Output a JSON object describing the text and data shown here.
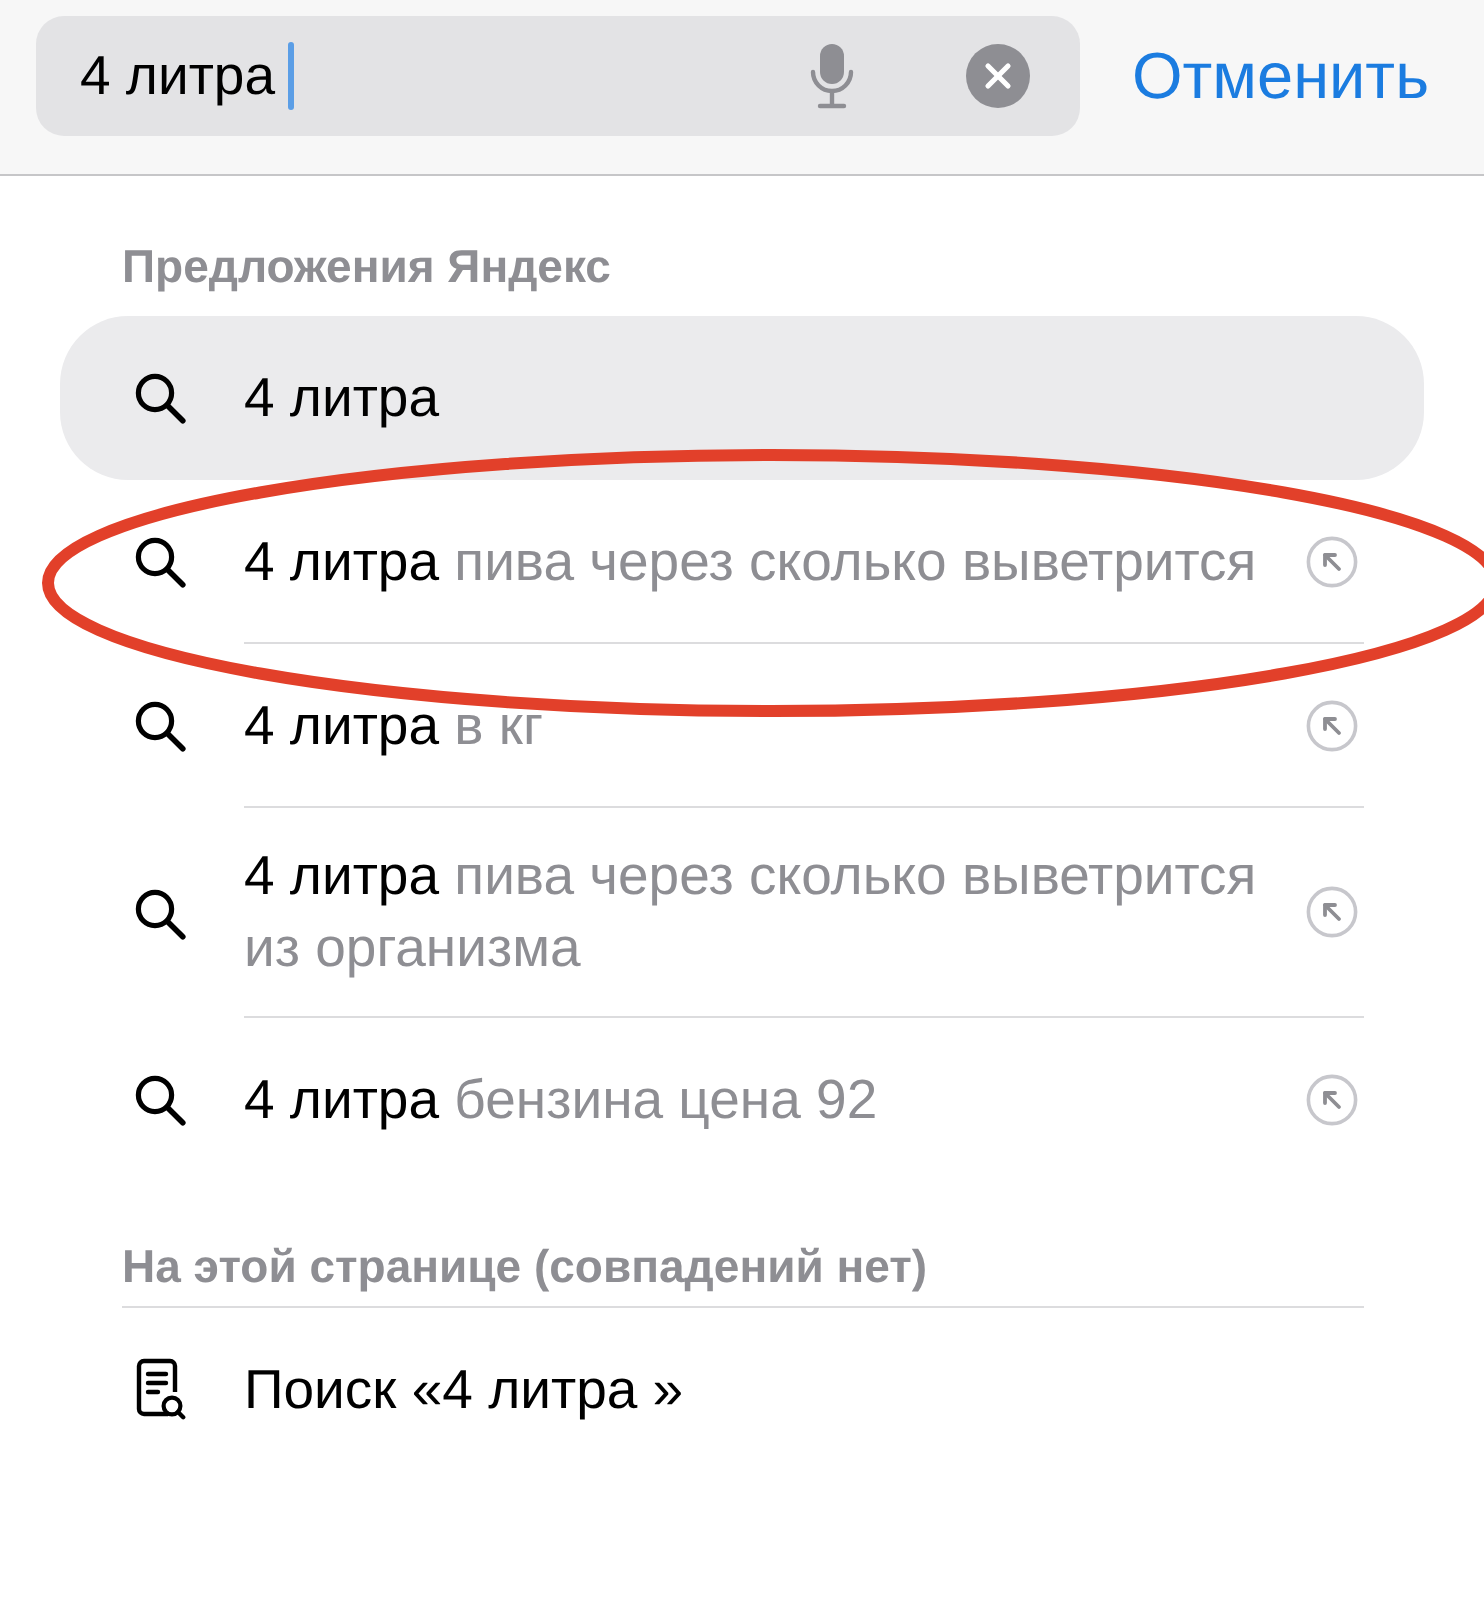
{
  "search_bar": {
    "value": "4 литра",
    "cancel_label": "Отменить"
  },
  "sections": [
    {
      "title": "Предложения Яндекс",
      "items": [
        {
          "kind": "suggestion",
          "query": "4 литра",
          "selected": true,
          "circled": false
        },
        {
          "kind": "suggestion",
          "query": "4 литра",
          "completion": "пива через сколько выветрится",
          "selected": false,
          "circled": true
        },
        {
          "kind": "suggestion",
          "query": "4 литра",
          "completion": "в кг",
          "selected": false,
          "circled": false
        },
        {
          "kind": "suggestion",
          "query": "4 литра",
          "completion": "пива через сколько выветрится из организма",
          "selected": false,
          "circled": false
        },
        {
          "kind": "suggestion",
          "query": "4 литра",
          "completion": "бензина цена 92",
          "selected": false,
          "circled": false
        }
      ]
    },
    {
      "title": "На этой странице (совпадений нет)",
      "items": [
        {
          "kind": "find_on_page",
          "query": "Поиск «4 литра »",
          "selected": false,
          "circled": false
        }
      ]
    }
  ]
}
